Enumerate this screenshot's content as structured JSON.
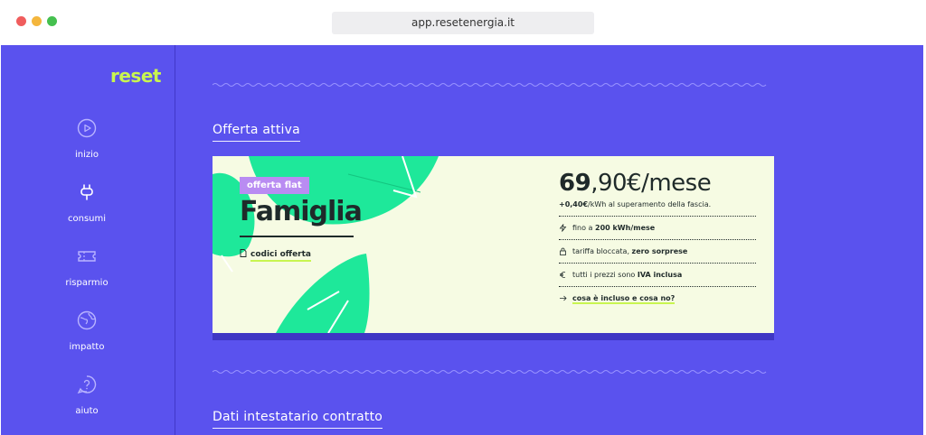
{
  "browser": {
    "url": "app.resetenergia.it"
  },
  "sidebar": {
    "logo": "reset",
    "items": [
      {
        "label": "inizio",
        "icon": "play-icon"
      },
      {
        "label": "consumi",
        "icon": "plug-icon"
      },
      {
        "label": "risparmio",
        "icon": "ticket-icon"
      },
      {
        "label": "impatto",
        "icon": "globe-icon"
      },
      {
        "label": "aiuto",
        "icon": "help-icon"
      }
    ]
  },
  "main": {
    "section1_title": "Offerta attiva",
    "section2_title": "Dati intestatario contratto",
    "offer": {
      "badge": "offerta flat",
      "name": "Famiglia",
      "codes_link": "codici offerta",
      "price_int": "69",
      "price_rest": ",90€/mese",
      "extra_bold": "+0,40€",
      "extra_rest": "/kWh al superamento della fascia.",
      "features": [
        {
          "icon": "bolt-icon",
          "text": "fino a ",
          "bold": "200 kWh/mese"
        },
        {
          "icon": "lock-icon",
          "text": "tariffa bloccata, ",
          "bold": "zero sorprese"
        },
        {
          "icon": "euro-icon",
          "text": "tutti i prezzi sono ",
          "bold": "IVA inclusa"
        }
      ],
      "included_link": "cosa è incluso e cosa no?"
    }
  },
  "colors": {
    "brand": "#5a52ee",
    "accent": "#c8f550",
    "badge": "#b98cf2",
    "leaf": "#1ee89a"
  }
}
